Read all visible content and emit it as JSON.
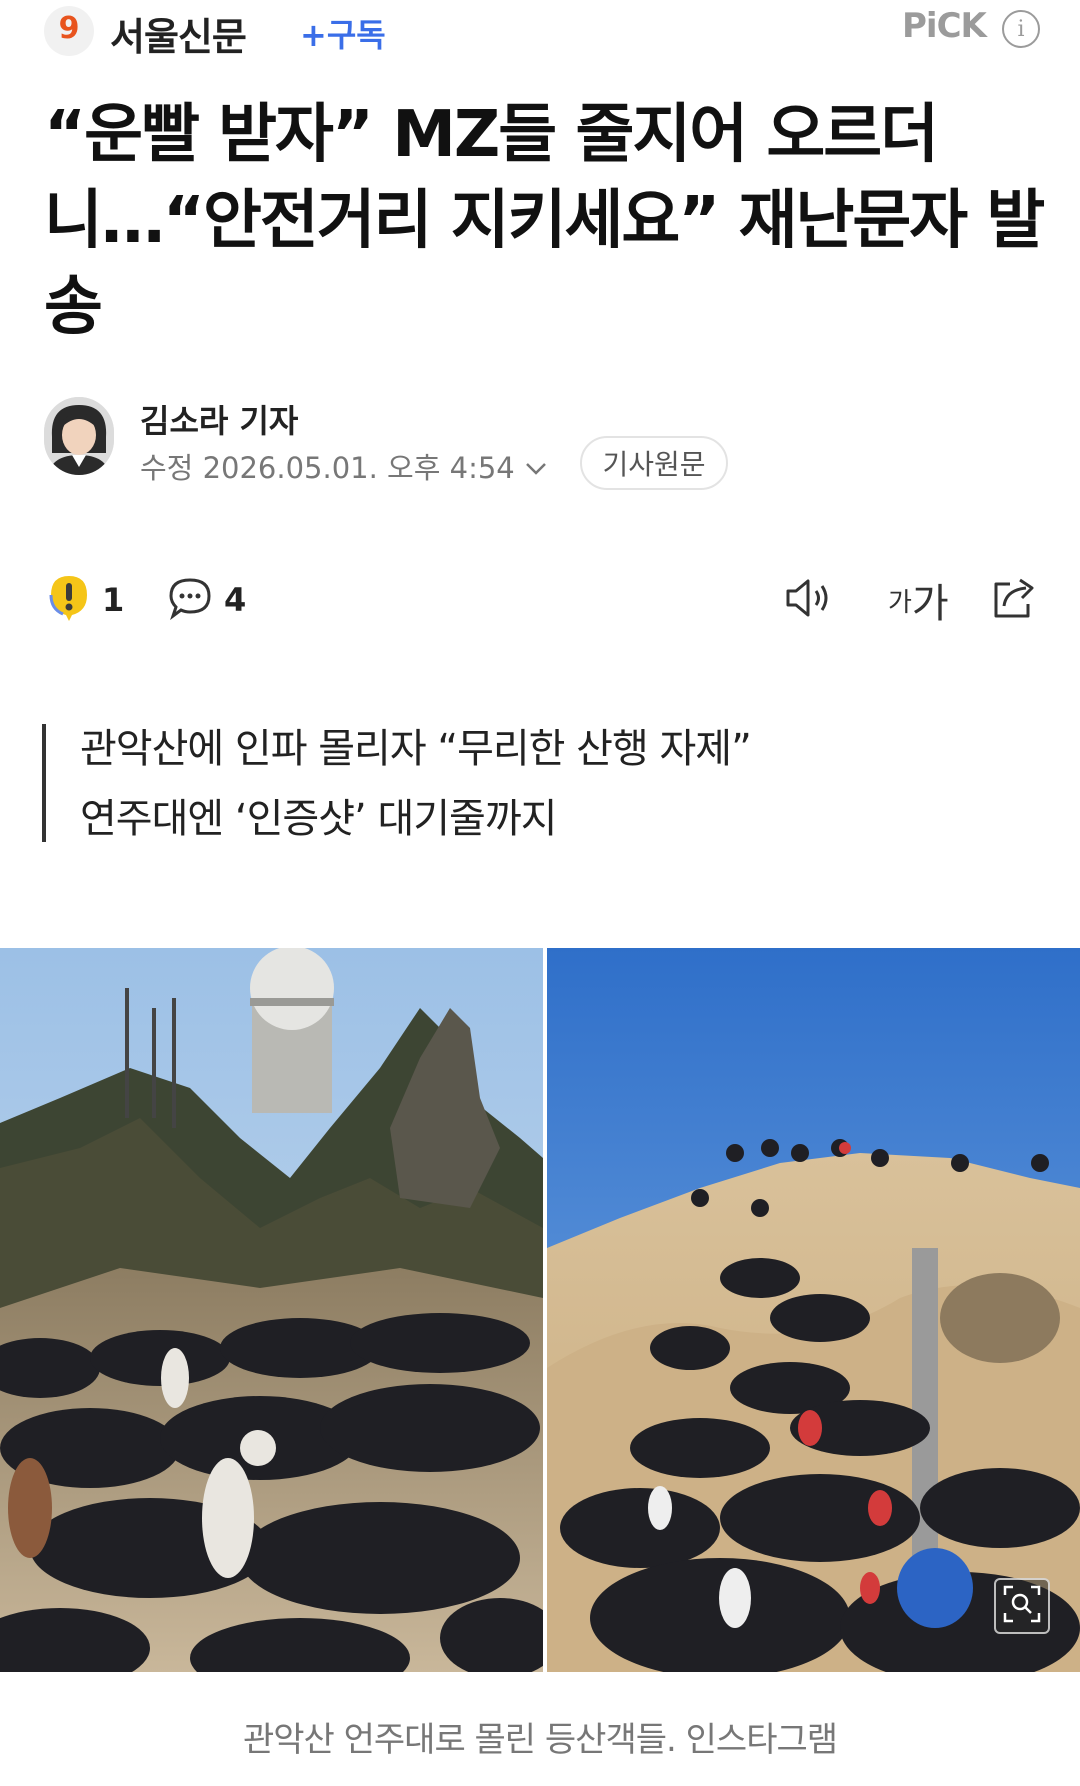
{
  "header": {
    "press_logo_glyph": "9",
    "press_name": "서울신문",
    "subscribe_label": "+구독",
    "pick_label": "PiCK",
    "info_icon": "i"
  },
  "article": {
    "title": "“운빨 받자” MZ들 줄지어 오르더니…“안전거리 지키세요” 재난문자 발송",
    "reporter": "김소라 기자",
    "date": "수정 2026.05.01. 오후 4:54",
    "original_label": "기사원문",
    "summary_lines": [
      "관악산에 인파 몰리자 “무리한 산행 자제”",
      "연주대엔 ‘인증샷’ 대기줄까지"
    ],
    "caption": "관악산 언주대로 몰린 등산객들. 인스타그램"
  },
  "actions": {
    "reaction_count": "1",
    "comment_count": "4",
    "font_label_small": "가",
    "font_label_large": "가"
  },
  "colors": {
    "accent_blue": "#3a6ee8",
    "logo_orange": "#e8541e",
    "reaction_yellow": "#f5c518"
  },
  "icons": {
    "reaction": "exclamation-bubble-icon",
    "comment": "speech-bubble-icon",
    "sound": "speaker-icon",
    "share": "share-arrow-icon",
    "zoom": "magnifier-icon"
  }
}
